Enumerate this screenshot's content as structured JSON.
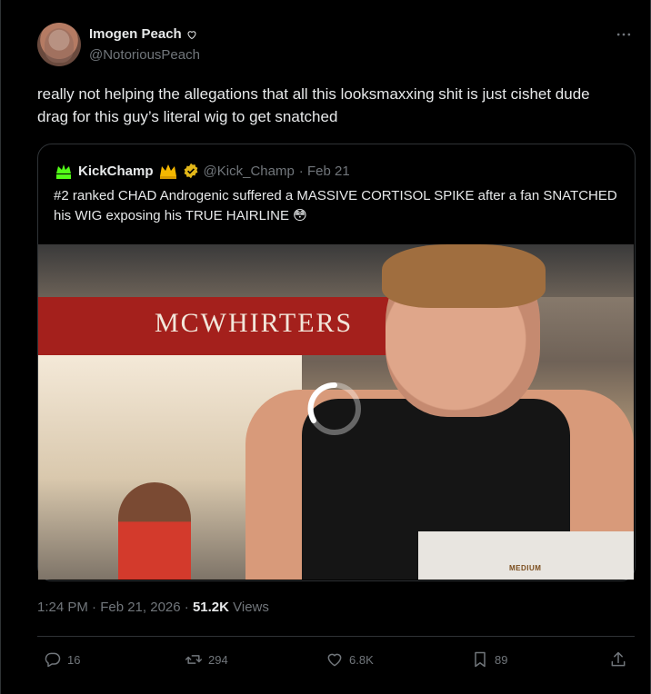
{
  "post": {
    "author_name": "Imogen Peach",
    "author_handle": "@NotoriousPeach",
    "text": "really not helping the allegations that all this looksmaxxing shit is just cishet dude drag for this guy’s literal wig to get snatched",
    "timestamp": "1:24 PM · Feb 21, 2026 · ",
    "views_count": "51.2K",
    "views_label": " Views"
  },
  "quote": {
    "author_name": "KickChamp",
    "author_handle": "@Kick_Champ",
    "date": " · Feb 21",
    "text": "#2 ranked CHAD Androgenic suffered a MASSIVE CORTISOL SPIKE after a fan SNATCHED his WIG exposing his TRUE HAIRLINE 😳",
    "media": {
      "sign_text": "MCWHIRTERS",
      "overlay_label": "MEDIUM"
    }
  },
  "actions": {
    "replies": "16",
    "reposts": "294",
    "likes": "6.8K",
    "bookmarks": "89"
  },
  "colors": {
    "background": "#000000",
    "text_primary": "#e7e9ea",
    "text_secondary": "#71767b",
    "border": "#2f3336",
    "verified_gold": "#e2b719"
  }
}
